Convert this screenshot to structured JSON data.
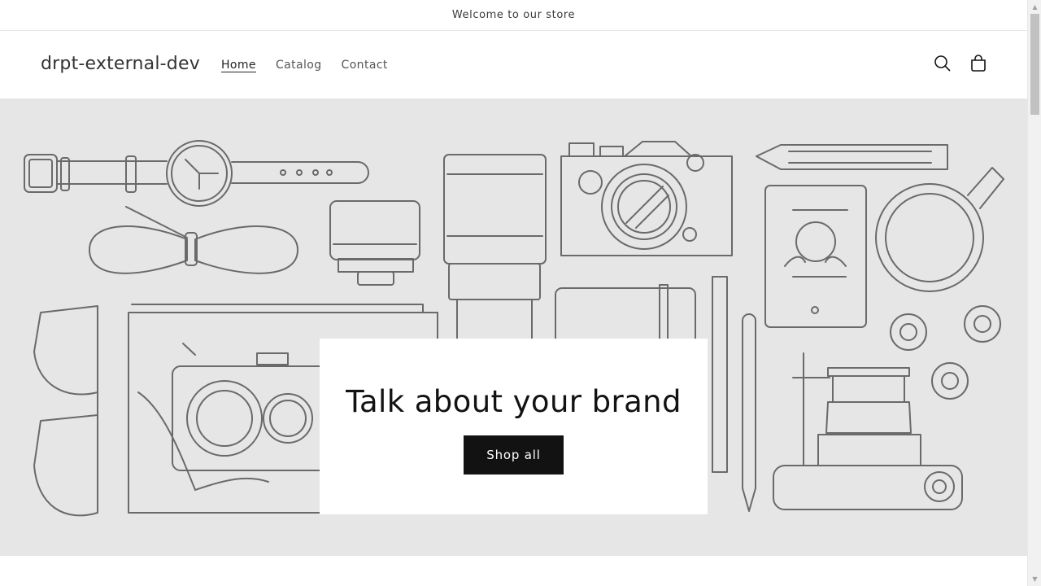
{
  "announcement": {
    "text": "Welcome to our store"
  },
  "header": {
    "logo": "drpt-external-dev",
    "nav": [
      {
        "label": "Home",
        "active": true
      },
      {
        "label": "Catalog",
        "active": false
      },
      {
        "label": "Contact",
        "active": false
      }
    ],
    "icons": {
      "search": "search-icon",
      "cart": "cart-icon"
    }
  },
  "hero": {
    "title": "Talk about your brand",
    "button_label": "Shop all"
  },
  "colors": {
    "hero_background": "#e6e6e6",
    "button_background": "#121212",
    "illustration_stroke": "#6a6a6a"
  }
}
